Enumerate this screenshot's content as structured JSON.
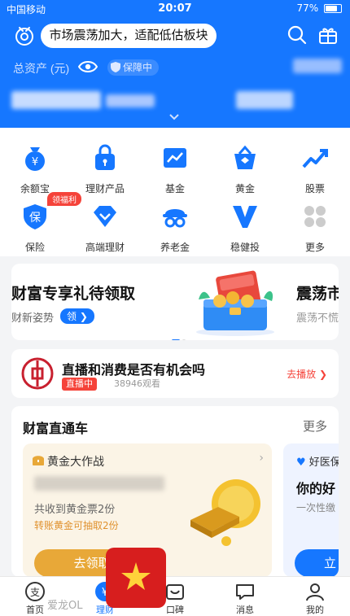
{
  "status": {
    "carrier": "中国移动",
    "time": "20:07",
    "battery": "77%"
  },
  "header": {
    "banner": "市场震荡加大，适配低估板块",
    "asset_label": "总资产 (元)",
    "protect_label": "保障中"
  },
  "grid": [
    {
      "label": "余额宝",
      "icon": "yuebao-icon"
    },
    {
      "label": "理财产品",
      "icon": "lock-bag-icon"
    },
    {
      "label": "基金",
      "icon": "fund-chart-icon"
    },
    {
      "label": "黄金",
      "icon": "gold-bag-icon"
    },
    {
      "label": "股票",
      "icon": "stock-trend-icon"
    },
    {
      "label": "保险",
      "icon": "insurance-shield-icon"
    },
    {
      "label": "高端理财",
      "icon": "diamond-icon"
    },
    {
      "label": "养老金",
      "icon": "pension-icon"
    },
    {
      "label": "稳健投",
      "icon": "v-icon"
    },
    {
      "label": "更多",
      "icon": "more-grid-icon"
    }
  ],
  "grid_tag": "领福利",
  "promo": {
    "title": "财富专享礼待领取",
    "subtitle": "财新姿势",
    "pill": "领",
    "title2": "震荡市",
    "subtitle2": "震荡不慌"
  },
  "live": {
    "title": "直播和消费是否有机会吗",
    "badge": "直播中",
    "views": "38946观看",
    "right": "去播放"
  },
  "wealth": {
    "heading": "财富直通车",
    "more": "更多",
    "gold": {
      "title": "黄金大作战",
      "sub1": "共收到黄金票2份",
      "sub2": "转账黄金可抽取2份",
      "button": "去领取"
    },
    "health": {
      "title": "好医保",
      "title2": "你的好",
      "sub": "一次性缴",
      "button": "立"
    }
  },
  "tabs": [
    {
      "label": "首页"
    },
    {
      "label": "理财"
    },
    {
      "label": "口碑"
    },
    {
      "label": "消息"
    },
    {
      "label": "我的"
    }
  ],
  "watermark": "爱龙OL",
  "colors": {
    "brand": "#1677ff",
    "accent": "#f5433a",
    "gold": "#e8a838"
  }
}
